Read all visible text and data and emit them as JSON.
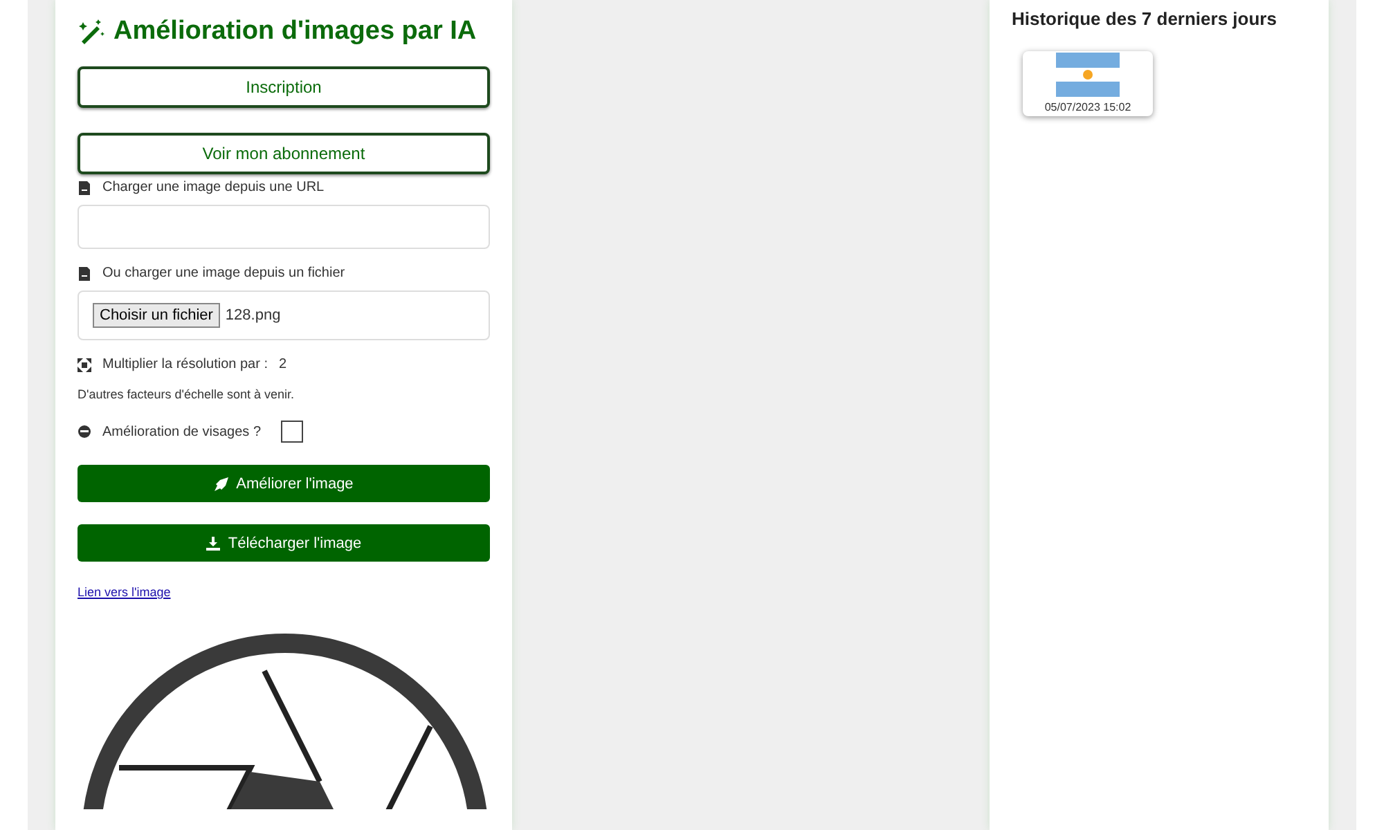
{
  "title": "Amélioration d'images par IA",
  "account_buttons": [
    "Inscription",
    "Voir mon abonnement"
  ],
  "url_field": {
    "label": "Charger une image depuis une URL"
  },
  "file_field": {
    "label": "Ou charger une image depuis un fichier",
    "button": "Choisir un fichier",
    "file_name": "128.png"
  },
  "scale": {
    "label": "Multiplier la résolution par :",
    "value": "2",
    "note": "D'autres facteurs d'échelle sont à venir."
  },
  "face_enhance": {
    "label": "Amélioration de visages ?",
    "checked": false
  },
  "action_buttons": [
    {
      "kind": "improve",
      "label": "Améliorer l'image"
    },
    {
      "kind": "download",
      "label": "Télécharger l'image"
    }
  ],
  "link": "Lien vers l'image",
  "history": {
    "title": "Historique des 7 derniers jours",
    "items": [
      {
        "date": "05/07/2023 15:02"
      }
    ]
  }
}
